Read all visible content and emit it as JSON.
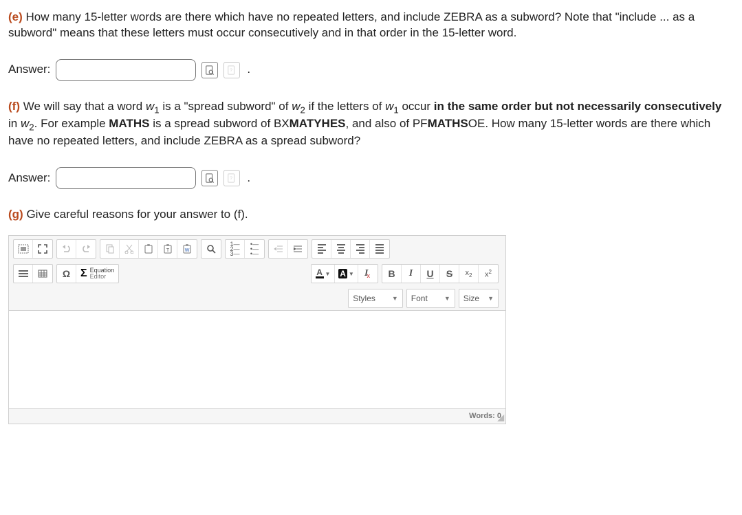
{
  "questions": {
    "e": {
      "label": "(e)",
      "text_pre": " How many 15-letter words are there which have no repeated letters, and include ZEBRA as a subword?  Note that \"include ... as a subword\" means that these letters must occur consecutively and in that order in the 15-letter word."
    },
    "f": {
      "label": "(f)",
      "pre1": " We will say that a word ",
      "w1": "w",
      "s1": "1",
      "mid1": " is a \"spread subword\" of ",
      "w2": "w",
      "s2": "2",
      "mid2": " if the letters of ",
      "w3": "w",
      "s3": "1",
      "mid3": " occur ",
      "bold1": "in the same order but not necessarily consecutively",
      "mid4": " in ",
      "w4": "w",
      "s4": "2",
      "mid5": ".  For example ",
      "bold2": "MATHS",
      "mid6": " is a spread subword of BX",
      "bold3": "MATYHES",
      "mid7": ", and also of PF",
      "bold4": "MATHS",
      "mid8": "OE.   How many 15-letter words are there which have no repeated letters, and include ZEBRA as a spread subword?"
    },
    "g": {
      "label": "(g)",
      "text": " Give careful reasons for your answer to (f)."
    }
  },
  "answer": {
    "label": "Answer:",
    "value_e": "",
    "value_f": "",
    "period": "."
  },
  "editor": {
    "equation_top": "Equation",
    "equation_bot": "Editor",
    "styles": "Styles",
    "font": "Font",
    "size": "Size",
    "words_label": "Words: 0"
  }
}
